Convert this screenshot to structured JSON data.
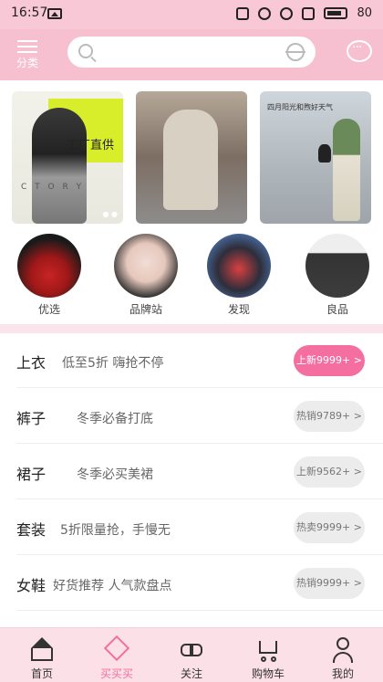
{
  "status": {
    "time": "16:57",
    "battery": "80"
  },
  "header": {
    "category_label": "分类",
    "search_placeholder": ""
  },
  "banner": {
    "card1_promo": "工厂直供",
    "card1_letters": "C T O R Y",
    "card3_text": "四月阳光和煦好天气"
  },
  "categories": [
    {
      "label": "优选"
    },
    {
      "label": "品牌站"
    },
    {
      "label": "发现"
    },
    {
      "label": "良品"
    }
  ],
  "list": [
    {
      "title": "上衣",
      "desc": "低至5折  嗨抢不停",
      "pill": "上新9999+ >",
      "active": true
    },
    {
      "title": "裤子",
      "desc": "冬季必备打底",
      "pill": "热销9789+ >",
      "active": false
    },
    {
      "title": "裙子",
      "desc": "冬季必买美裙",
      "pill": "上新9562+ >",
      "active": false
    },
    {
      "title": "套装",
      "desc": "5折限量抢，手慢无",
      "pill": "热卖9999+ >",
      "active": false
    },
    {
      "title": "女鞋",
      "desc": "好货推荐  人气款盘点",
      "pill": "热销9999+ >",
      "active": false
    }
  ],
  "nav": [
    {
      "label": "首页"
    },
    {
      "label": "买买买"
    },
    {
      "label": "关注"
    },
    {
      "label": "购物车"
    },
    {
      "label": "我的"
    }
  ],
  "colors": {
    "accent": "#f46fa0",
    "header_bg": "#f7c0d1",
    "nav_bg": "#fbe0e8"
  }
}
